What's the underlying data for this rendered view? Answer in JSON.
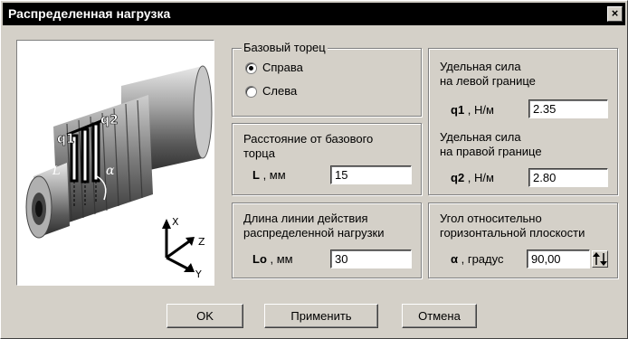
{
  "window": {
    "title": "Распределенная нагрузка",
    "close_label": "×"
  },
  "preview": {
    "labels": {
      "q1": "q1",
      "q2": "q2",
      "L": "L",
      "alpha": "α"
    },
    "axes": {
      "x": "X",
      "y": "Y",
      "z": "Z"
    }
  },
  "base_face": {
    "title": "Базовый торец",
    "options": [
      {
        "label": "Справа",
        "selected": true
      },
      {
        "label": "Слева",
        "selected": false
      }
    ]
  },
  "distance": {
    "title_line1": "Расстояние от базового",
    "title_line2": "торца",
    "symbol": "L",
    "unit": " , мм",
    "value": "15"
  },
  "length": {
    "title_line1": "Длина линии действия",
    "title_line2": "распределенной нагрузки",
    "symbol": "Lo",
    "unit": " , мм",
    "value": "30"
  },
  "force": {
    "q1_line1": "Удельная сила",
    "q1_line2": "на левой границе",
    "q1_symbol": "q1",
    "q1_unit": " , Н/м",
    "q1_value": "2.35",
    "q2_line1": "Удельная сила",
    "q2_line2": "на правой границе",
    "q2_symbol": "q2",
    "q2_unit": " , Н/м",
    "q2_value": "2.80"
  },
  "angle": {
    "title_line1": "Угол относительно",
    "title_line2": "горизонтальной плоскости",
    "symbol": "α",
    "unit": " , градус",
    "value": "90,00"
  },
  "buttons": {
    "ok": "OK",
    "apply": "Применить",
    "cancel": "Отмена"
  }
}
